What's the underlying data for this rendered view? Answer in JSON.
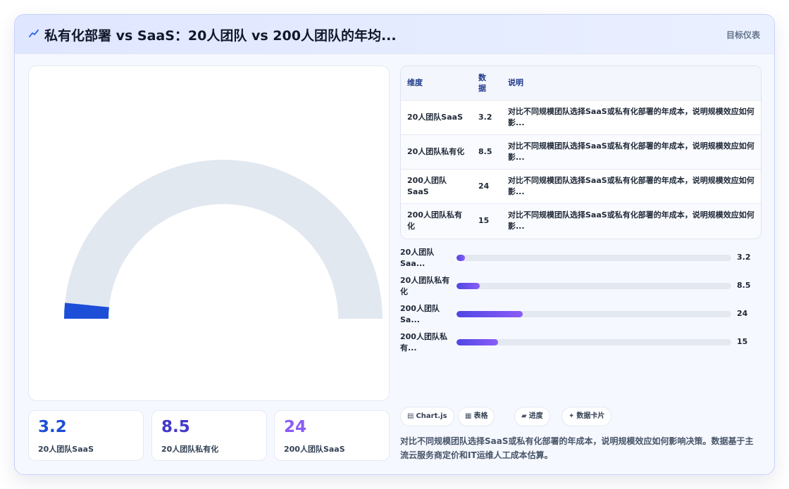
{
  "header": {
    "title": "私有化部署 vs SaaS：20人团队 vs 200人团队的年均...",
    "right_label": "目标仪表",
    "icon": "chart-line-icon"
  },
  "gauge": {
    "value": 3.2,
    "max": 100,
    "fill_color": "#1d4ed8",
    "track_color": "#e2e8f0"
  },
  "kpis": [
    {
      "value": "3.2",
      "label": "20人团队SaaS",
      "color": "#1d4ed8"
    },
    {
      "value": "8.5",
      "label": "20人团队私有化",
      "color": "#4338ca"
    },
    {
      "value": "24",
      "label": "200人团队SaaS",
      "color": "#8b5cf6"
    }
  ],
  "table": {
    "headers": [
      "维度",
      "数据",
      "说明"
    ],
    "rows": [
      {
        "dimension": "20人团队SaaS",
        "value": "3.2",
        "description": "对比不同规模团队选择SaaS或私有化部署的年成本，说明规模效应如何影..."
      },
      {
        "dimension": "20人团队私有化",
        "value": "8.5",
        "description": "对比不同规模团队选择SaaS或私有化部署的年成本，说明规模效应如何影..."
      },
      {
        "dimension": "200人团队SaaS",
        "value": "24",
        "description": "对比不同规模团队选择SaaS或私有化部署的年成本，说明规模效应如何影..."
      },
      {
        "dimension": "200人团队私有化",
        "value": "15",
        "description": "对比不同规模团队选择SaaS或私有化部署的年成本，说明规模效应如何影..."
      }
    ]
  },
  "progress": {
    "max": 100,
    "items": [
      {
        "label": "20人团队Saa...",
        "value": 3.2,
        "display": "3.2"
      },
      {
        "label": "20人团队私有化",
        "value": 8.5,
        "display": "8.5"
      },
      {
        "label": "200人团队Sa...",
        "value": 24,
        "display": "24"
      },
      {
        "label": "200人团队私有...",
        "value": 15,
        "display": "15"
      }
    ]
  },
  "chips": [
    {
      "icon": "grid-icon",
      "glyph": "▤",
      "label": "Chart.js"
    },
    {
      "icon": "table-icon",
      "glyph": "▦",
      "label": "表格"
    },
    {
      "icon": "progress-icon",
      "glyph": "▰",
      "label": "进度"
    },
    {
      "icon": "sparkle-icon",
      "glyph": "✦",
      "label": "数据卡片"
    }
  ],
  "footnote": "对比不同规模团队选择SaaS或私有化部署的年成本，说明规模效应如何影响决策。数据基于主流云服务商定价和IT运维人工成本估算。"
}
